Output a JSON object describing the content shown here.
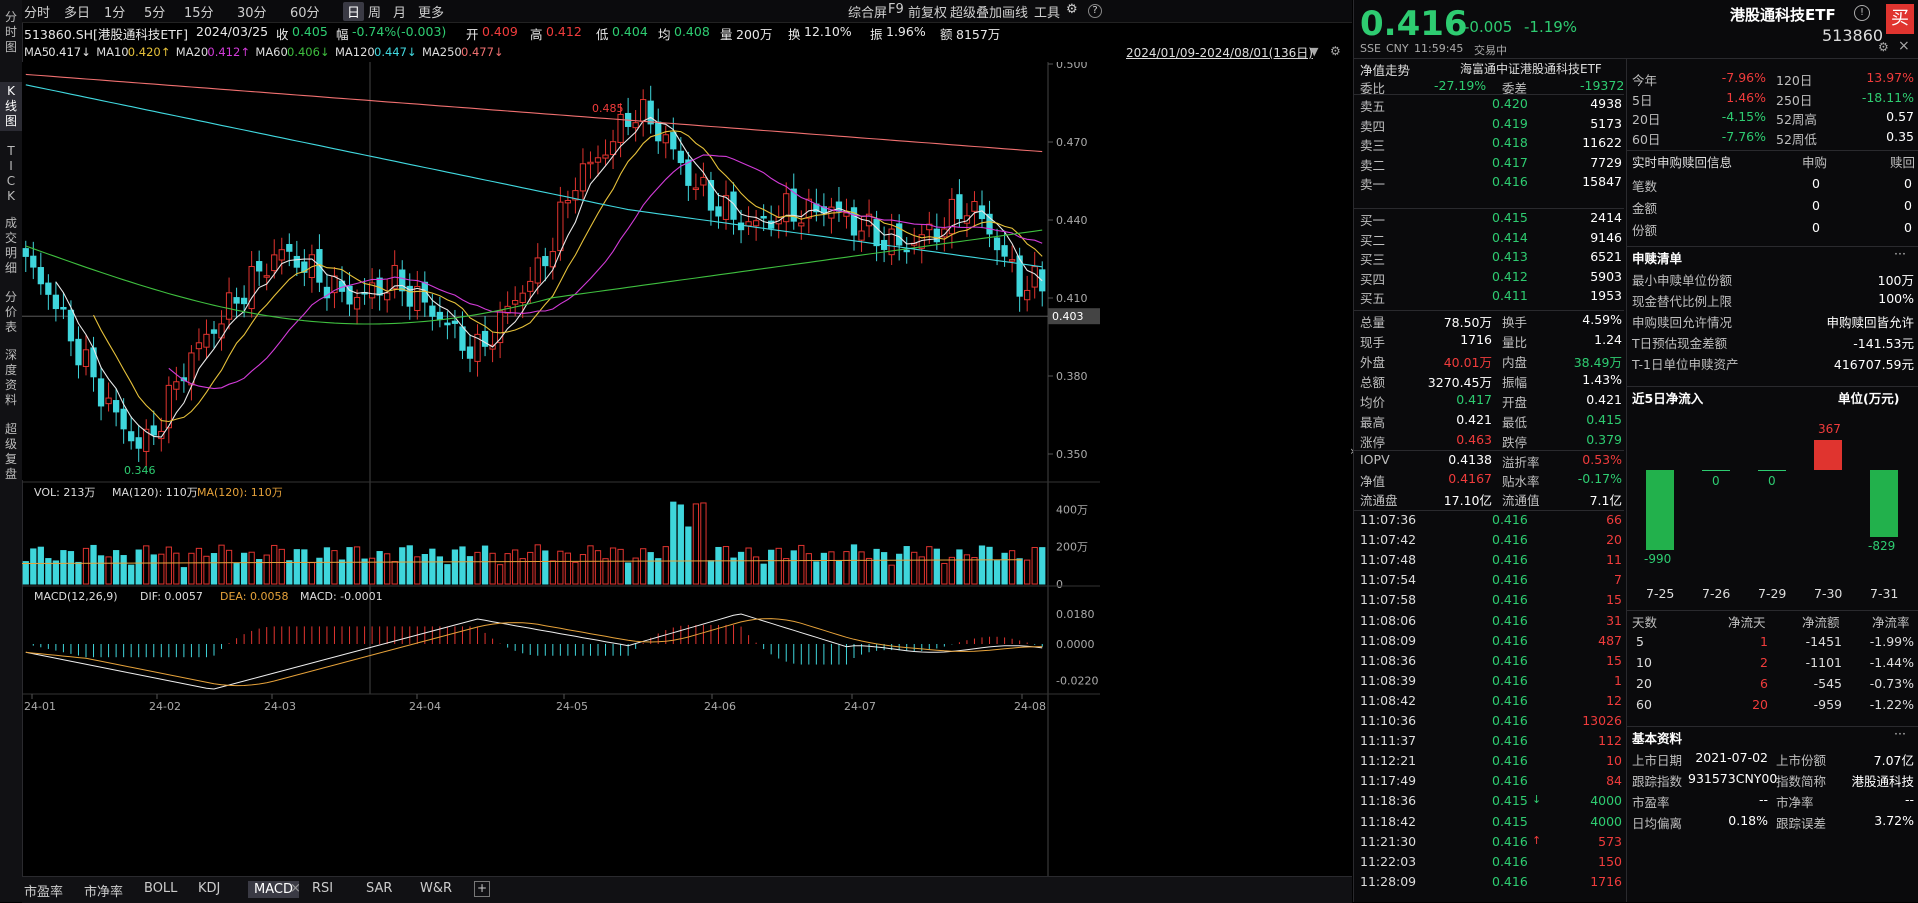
{
  "left_tabs": [
    "分时图",
    "K线图",
    "TICK",
    "成交明细",
    "分价表",
    "深度资料",
    "超级复盘"
  ],
  "toolbar": {
    "periods": [
      "分时",
      "多日",
      "1分",
      "5分",
      "15分",
      "30分",
      "60分",
      "日",
      "周",
      "月",
      "更多"
    ],
    "active": "日",
    "right": [
      "综合屏",
      "F9",
      "前复权",
      "超级叠加",
      "画线",
      "工具"
    ]
  },
  "info": {
    "code": "513860.SH[港股通科技ETF]",
    "date": "2024/03/25",
    "close_lbl": "收",
    "close": "0.405",
    "chg_lbl": "幅",
    "chg": "-0.74%(-0.003)",
    "open_lbl": "开",
    "open": "0.409",
    "high_lbl": "高",
    "high": "0.412",
    "low_lbl": "低",
    "low": "0.404",
    "avg_lbl": "均",
    "avg": "0.408",
    "vol_lbl": "量",
    "vol": "200万",
    "turn_lbl": "换",
    "turn": "12.10%",
    "amp_lbl": "振",
    "amp": "1.96%",
    "amt_lbl": "额",
    "amt": "8157万"
  },
  "ma": [
    {
      "name": "MA5",
      "value": "0.417↓",
      "color": "#e8e8e8"
    },
    {
      "name": "MA10",
      "value": "0.420↑",
      "color": "#e6c13a"
    },
    {
      "name": "MA20",
      "value": "0.412↑",
      "color": "#d23bd8"
    },
    {
      "name": "MA60",
      "value": "0.406↓",
      "color": "#3fbf3f"
    },
    {
      "name": "MA120",
      "value": "0.447↓",
      "color": "#41d9e0"
    },
    {
      "name": "MA250",
      "value": "0.477↓",
      "color": "#f07070"
    }
  ],
  "date_range": "2024/01/09-2024/08/01(136日)",
  "price_axis": [
    "0.500",
    "0.470",
    "0.440",
    "0.410",
    "0.380",
    "0.350"
  ],
  "crosshair_price": "0.403",
  "annot_high": "0.485",
  "annot_low": "0.346",
  "vol_header": {
    "label": "VOL: 213万",
    "ma1": "MA(120): 110万",
    "ma2": "MA(120): 110万"
  },
  "vol_axis": [
    "400万",
    "200万",
    "0"
  ],
  "macd_header": {
    "label": "MACD(12,26,9)",
    "dif": "DIF: 0.0057",
    "dea": "DEA: 0.0058",
    "macd": "MACD: -0.0001"
  },
  "macd_axis": [
    "0.0180",
    "0.0000",
    "-0.0220"
  ],
  "x_axis": [
    "24-01",
    "24-02",
    "24-03",
    "24-04",
    "24-05",
    "24-06",
    "24-07",
    "24-08"
  ],
  "bottom_tabs": [
    "市盈率",
    "市净率",
    "BOLL",
    "KDJ",
    "MACD",
    "RSI",
    "SAR",
    "W&R"
  ],
  "bottom_active": "MACD",
  "chart_data": {
    "type": "candlestick",
    "title": "513860.SH 港股通科技ETF 日K",
    "ylim": [
      0.34,
      0.5
    ],
    "x_range": [
      "2024/01/09",
      "2024/08/01"
    ],
    "series": [
      {
        "name": "close_trend",
        "values": [
          0.423,
          0.415,
          0.4,
          0.385,
          0.372,
          0.36,
          0.352,
          0.365,
          0.382,
          0.393,
          0.402,
          0.412,
          0.42,
          0.428,
          0.424,
          0.418,
          0.412,
          0.41,
          0.414,
          0.416,
          0.41,
          0.404,
          0.396,
          0.388,
          0.398,
          0.41,
          0.418,
          0.432,
          0.455,
          0.462,
          0.47,
          0.482,
          0.478,
          0.468,
          0.455,
          0.448,
          0.442,
          0.438,
          0.44,
          0.444,
          0.442,
          0.446,
          0.44,
          0.436,
          0.432,
          0.43,
          0.434,
          0.438,
          0.446,
          0.44,
          0.426,
          0.414,
          0.416
        ]
      }
    ],
    "volume_max": "400万"
  },
  "rp": {
    "price": "0.416",
    "chg": "-0.005",
    "pct": "-1.19%",
    "name": "港股通科技ETF",
    "code": "513860",
    "buy": "买",
    "meta": [
      "SSE",
      "CNY",
      "11:59:45",
      "交易中"
    ],
    "nav_title": "净值走势",
    "nav_index": "海富通中证港股通科技ETF",
    "wb": {
      "l1": "委比",
      "v1": "-27.19%",
      "l2": "委差",
      "v2": "-19372"
    },
    "asks": [
      {
        "l": "卖五",
        "p": "0.420",
        "v": "4938"
      },
      {
        "l": "卖四",
        "p": "0.419",
        "v": "5173"
      },
      {
        "l": "卖三",
        "p": "0.418",
        "v": "11622"
      },
      {
        "l": "卖二",
        "p": "0.417",
        "v": "7729"
      },
      {
        "l": "卖一",
        "p": "0.416",
        "v": "15847"
      }
    ],
    "bids": [
      {
        "l": "买一",
        "p": "0.415",
        "v": "2414"
      },
      {
        "l": "买二",
        "p": "0.414",
        "v": "9146"
      },
      {
        "l": "买三",
        "p": "0.413",
        "v": "6521"
      },
      {
        "l": "买四",
        "p": "0.412",
        "v": "5903"
      },
      {
        "l": "买五",
        "p": "0.411",
        "v": "1953"
      }
    ],
    "stats": [
      {
        "l1": "总量",
        "v1": "78.50万",
        "c1": "white",
        "l2": "换手",
        "v2": "4.59%",
        "c2": "white"
      },
      {
        "l1": "现手",
        "v1": "1716",
        "c1": "white",
        "l2": "量比",
        "v2": "1.24",
        "c2": "white"
      },
      {
        "l1": "外盘",
        "v1": "40.01万",
        "c1": "red",
        "l2": "内盘",
        "v2": "38.49万",
        "c2": "green"
      },
      {
        "l1": "总额",
        "v1": "3270.45万",
        "c1": "white",
        "l2": "振幅",
        "v2": "1.43%",
        "c2": "white"
      },
      {
        "l1": "均价",
        "v1": "0.417",
        "c1": "green",
        "l2": "开盘",
        "v2": "0.421",
        "c2": "white"
      },
      {
        "l1": "最高",
        "v1": "0.421",
        "c1": "white",
        "l2": "最低",
        "v2": "0.415",
        "c2": "green"
      },
      {
        "l1": "涨停",
        "v1": "0.463",
        "c1": "red",
        "l2": "跌停",
        "v2": "0.379",
        "c2": "green"
      }
    ],
    "iopv": [
      {
        "l1": "IOPV",
        "v1": "0.4138",
        "c1": "white",
        "l2": "溢折率",
        "v2": "0.53%",
        "c2": "red"
      },
      {
        "l1": "净值",
        "v1": "0.4167",
        "c1": "red",
        "l2": "贴水率",
        "v2": "-0.17%",
        "c2": "green"
      },
      {
        "l1": "流通盘",
        "v1": "17.10亿",
        "c1": "white",
        "l2": "流通值",
        "v2": "7.1亿",
        "c2": "white"
      }
    ],
    "ticks": [
      {
        "t": "11:07:36",
        "p": "0.416",
        "v": "66",
        "c": "red",
        "a": ""
      },
      {
        "t": "11:07:42",
        "p": "0.416",
        "v": "20",
        "c": "red",
        "a": ""
      },
      {
        "t": "11:07:48",
        "p": "0.416",
        "v": "11",
        "c": "red",
        "a": ""
      },
      {
        "t": "11:07:54",
        "p": "0.416",
        "v": "7",
        "c": "red",
        "a": ""
      },
      {
        "t": "11:07:58",
        "p": "0.416",
        "v": "15",
        "c": "red",
        "a": ""
      },
      {
        "t": "11:08:06",
        "p": "0.416",
        "v": "31",
        "c": "red",
        "a": ""
      },
      {
        "t": "11:08:09",
        "p": "0.416",
        "v": "487",
        "c": "red",
        "a": ""
      },
      {
        "t": "11:08:36",
        "p": "0.416",
        "v": "15",
        "c": "red",
        "a": ""
      },
      {
        "t": "11:08:39",
        "p": "0.416",
        "v": "1",
        "c": "red",
        "a": ""
      },
      {
        "t": "11:08:42",
        "p": "0.416",
        "v": "12",
        "c": "red",
        "a": ""
      },
      {
        "t": "11:10:36",
        "p": "0.416",
        "v": "13026",
        "c": "red",
        "a": ""
      },
      {
        "t": "11:11:37",
        "p": "0.416",
        "v": "112",
        "c": "red",
        "a": ""
      },
      {
        "t": "11:12:21",
        "p": "0.416",
        "v": "10",
        "c": "red",
        "a": ""
      },
      {
        "t": "11:17:49",
        "p": "0.416",
        "v": "84",
        "c": "red",
        "a": ""
      },
      {
        "t": "11:18:36",
        "p": "0.415",
        "v": "4000",
        "c": "green",
        "a": "↓"
      },
      {
        "t": "11:18:42",
        "p": "0.415",
        "v": "4000",
        "c": "green",
        "a": ""
      },
      {
        "t": "11:21:30",
        "p": "0.416",
        "v": "573",
        "c": "red",
        "a": "↑"
      },
      {
        "t": "11:22:03",
        "p": "0.416",
        "v": "150",
        "c": "red",
        "a": ""
      },
      {
        "t": "11:28:09",
        "p": "0.416",
        "v": "1716",
        "c": "red",
        "a": ""
      }
    ],
    "perf": [
      {
        "l1": "今年",
        "v1": "-7.96%",
        "c1": "red",
        "l2": "120日",
        "v2": "13.97%",
        "c2": "red"
      },
      {
        "l1": "5日",
        "v1": "1.46%",
        "c1": "red",
        "l2": "250日",
        "v2": "-18.11%",
        "c2": "green"
      },
      {
        "l1": "20日",
        "v1": "-4.15%",
        "c1": "green",
        "l2": "52周高",
        "v2": "0.57",
        "c2": "white"
      },
      {
        "l1": "60日",
        "v1": "-7.76%",
        "c1": "green",
        "l2": "52周低",
        "v2": "0.35",
        "c2": "white"
      }
    ],
    "sub_title": "实时申购赎回信息",
    "sub_c1": "申购",
    "sub_c2": "赎回",
    "sub_rows": [
      {
        "l": "笔数",
        "a": "0",
        "b": "0"
      },
      {
        "l": "金额",
        "a": "0",
        "b": "0"
      },
      {
        "l": "份额",
        "a": "0",
        "b": "0"
      }
    ],
    "list_title": "申赎清单",
    "list_more": "···",
    "list_rows": [
      {
        "l": "最小申赎单位份额",
        "v": "100万"
      },
      {
        "l": "现金替代比例上限",
        "v": "100%"
      },
      {
        "l": "申购赎回允许情况",
        "v": "申购赎回皆允许"
      },
      {
        "l": "T日预估现金差额",
        "v": "-141.53元"
      },
      {
        "l": "T-1日单位申赎资产",
        "v": "416707.59元"
      }
    ],
    "flow_title": "近5日净流入",
    "flow_unit": "单位(万元)",
    "flow": [
      {
        "d": "7-25",
        "v": -990
      },
      {
        "d": "7-26",
        "v": 0
      },
      {
        "d": "7-29",
        "v": 0
      },
      {
        "d": "7-30",
        "v": 367
      },
      {
        "d": "7-31",
        "v": -829
      }
    ],
    "flow_hdr": [
      "天数",
      "净流天",
      "净流额",
      "净流率"
    ],
    "flow_rows": [
      {
        "d": "5",
        "n": "1",
        "a": "-1451",
        "r": "-1.99%"
      },
      {
        "d": "10",
        "n": "2",
        "a": "-1101",
        "r": "-1.44%"
      },
      {
        "d": "20",
        "n": "6",
        "a": "-545",
        "r": "-0.73%"
      },
      {
        "d": "60",
        "n": "20",
        "a": "-959",
        "r": "-1.22%"
      }
    ],
    "basic_title": "基本资料",
    "basic_more": "···",
    "basic": [
      {
        "l1": "上市日期",
        "v1": "2021-07-02",
        "l2": "上市份额",
        "v2": "7.07亿"
      },
      {
        "l1": "跟踪指数",
        "v1": "931573CNY00",
        "l2": "指数简称",
        "v2": "港股通科技"
      },
      {
        "l1": "市盈率",
        "v1": "--",
        "l2": "市净率",
        "v2": "--"
      },
      {
        "l1": "日均偏离",
        "v1": "0.18%",
        "l2": "跟踪误差",
        "v2": "3.72%"
      }
    ]
  }
}
